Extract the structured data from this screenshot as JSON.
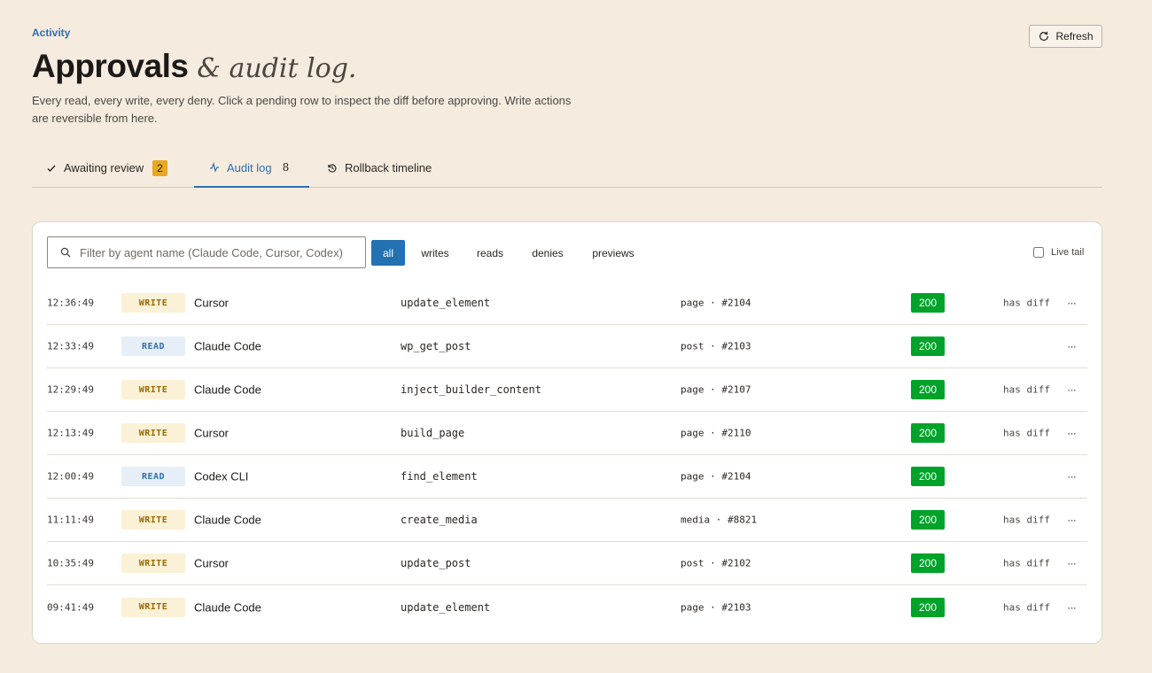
{
  "header": {
    "eyebrow": "Activity",
    "title_main": "Approvals",
    "title_italic": "& audit log.",
    "subtitle": "Every read, every write, every deny. Click a pending row to inspect the diff before approving. Write actions are reversible from here.",
    "refresh_label": "Refresh"
  },
  "tabs": [
    {
      "label": "Awaiting review",
      "count": "2",
      "icon": "check-icon"
    },
    {
      "label": "Audit log",
      "count": "8",
      "icon": "activity-icon",
      "active": true
    },
    {
      "label": "Rollback timeline",
      "icon": "history-icon"
    }
  ],
  "toolbar": {
    "search_placeholder": "Filter by agent name (Claude Code, Cursor, Codex)",
    "filters": [
      "all",
      "writes",
      "reads",
      "denies",
      "previews"
    ],
    "active_filter": "all",
    "live_tail_label": "Live tail",
    "live_tail_checked": false
  },
  "log_rows": [
    {
      "time": "12:36:49",
      "kind": "WRITE",
      "agent": "Cursor",
      "tool": "update_element",
      "target": "page · #2104",
      "status": "200",
      "diff": "has diff"
    },
    {
      "time": "12:33:49",
      "kind": "READ",
      "agent": "Claude Code",
      "tool": "wp_get_post",
      "target": "post · #2103",
      "status": "200",
      "diff": ""
    },
    {
      "time": "12:29:49",
      "kind": "WRITE",
      "agent": "Claude Code",
      "tool": "inject_builder_content",
      "target": "page · #2107",
      "status": "200",
      "diff": "has diff"
    },
    {
      "time": "12:13:49",
      "kind": "WRITE",
      "agent": "Cursor",
      "tool": "build_page",
      "target": "page · #2110",
      "status": "200",
      "diff": "has diff"
    },
    {
      "time": "12:00:49",
      "kind": "READ",
      "agent": "Codex CLI",
      "tool": "find_element",
      "target": "page · #2104",
      "status": "200",
      "diff": ""
    },
    {
      "time": "11:11:49",
      "kind": "WRITE",
      "agent": "Claude Code",
      "tool": "create_media",
      "target": "media · #8821",
      "status": "200",
      "diff": "has diff"
    },
    {
      "time": "10:35:49",
      "kind": "WRITE",
      "agent": "Cursor",
      "tool": "update_post",
      "target": "post · #2102",
      "status": "200",
      "diff": "has diff"
    },
    {
      "time": "09:41:49",
      "kind": "WRITE",
      "agent": "Claude Code",
      "tool": "update_element",
      "target": "page · #2103",
      "status": "200",
      "diff": "has diff"
    }
  ],
  "row_menu_glyph": "···",
  "colors": {
    "background": "#f5ecdf",
    "accent": "#2271b1",
    "badge_pending": "#e8a823",
    "status_ok": "#00a32a",
    "write_badge_bg": "#fbf1d6",
    "write_badge_text": "#9a6a00",
    "read_badge_bg": "#e6eff8",
    "read_badge_text": "#2f6fb0"
  }
}
